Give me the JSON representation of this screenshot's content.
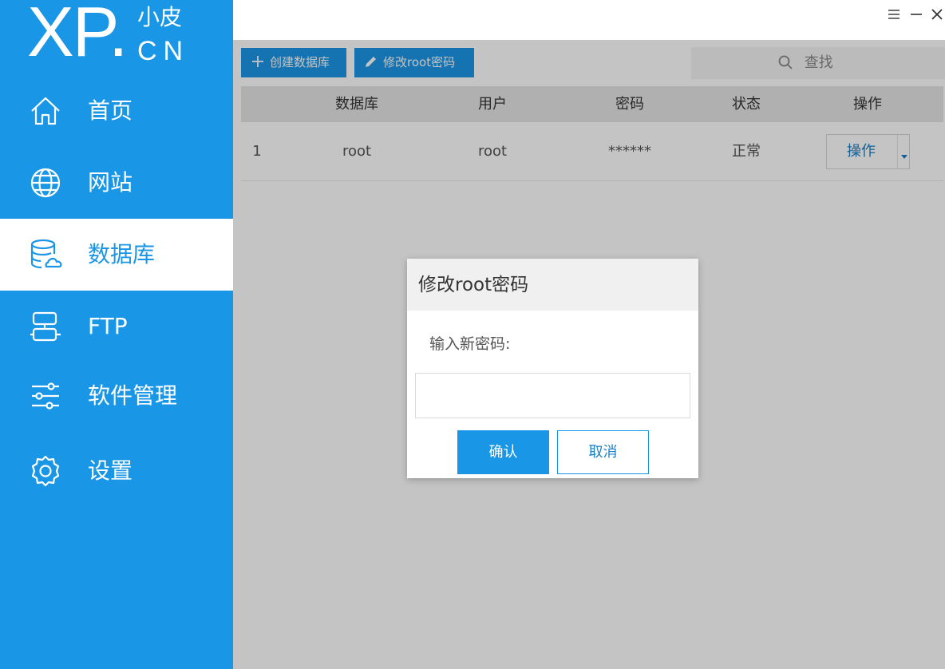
{
  "logo": {
    "main": "XP.",
    "top": "小皮",
    "bottom": "CN"
  },
  "sidebar": {
    "items": [
      {
        "label": "首页",
        "icon": "home-icon",
        "active": false
      },
      {
        "label": "网站",
        "icon": "globe-icon",
        "active": false
      },
      {
        "label": "数据库",
        "icon": "database-icon",
        "active": true
      },
      {
        "label": "FTP",
        "icon": "ftp-icon",
        "active": false
      },
      {
        "label": "软件管理",
        "icon": "sliders-icon",
        "active": false
      },
      {
        "label": "设置",
        "icon": "gear-icon",
        "active": false
      }
    ]
  },
  "window": {
    "menu_icon": "menu-icon",
    "minimize_icon": "minimize-icon",
    "close_icon": "close-icon"
  },
  "toolbar": {
    "create_label": "创建数据库",
    "change_root_label": "修改root密码",
    "search_label": "查找"
  },
  "table": {
    "headers": [
      "",
      "数据库",
      "用户",
      "密码",
      "状态",
      "操作"
    ],
    "rows": [
      {
        "index": "1",
        "database": "root",
        "user": "root",
        "password": "******",
        "status": "正常",
        "action": "操作"
      }
    ]
  },
  "dialog": {
    "title": "修改root密码",
    "prompt": "输入新密码:",
    "input_value": "",
    "ok_label": "确认",
    "cancel_label": "取消"
  },
  "colors": {
    "accent": "#1a96e6",
    "overlay": "rgba(0,0,0,0.23)",
    "header_bg": "#e6e6e6"
  }
}
